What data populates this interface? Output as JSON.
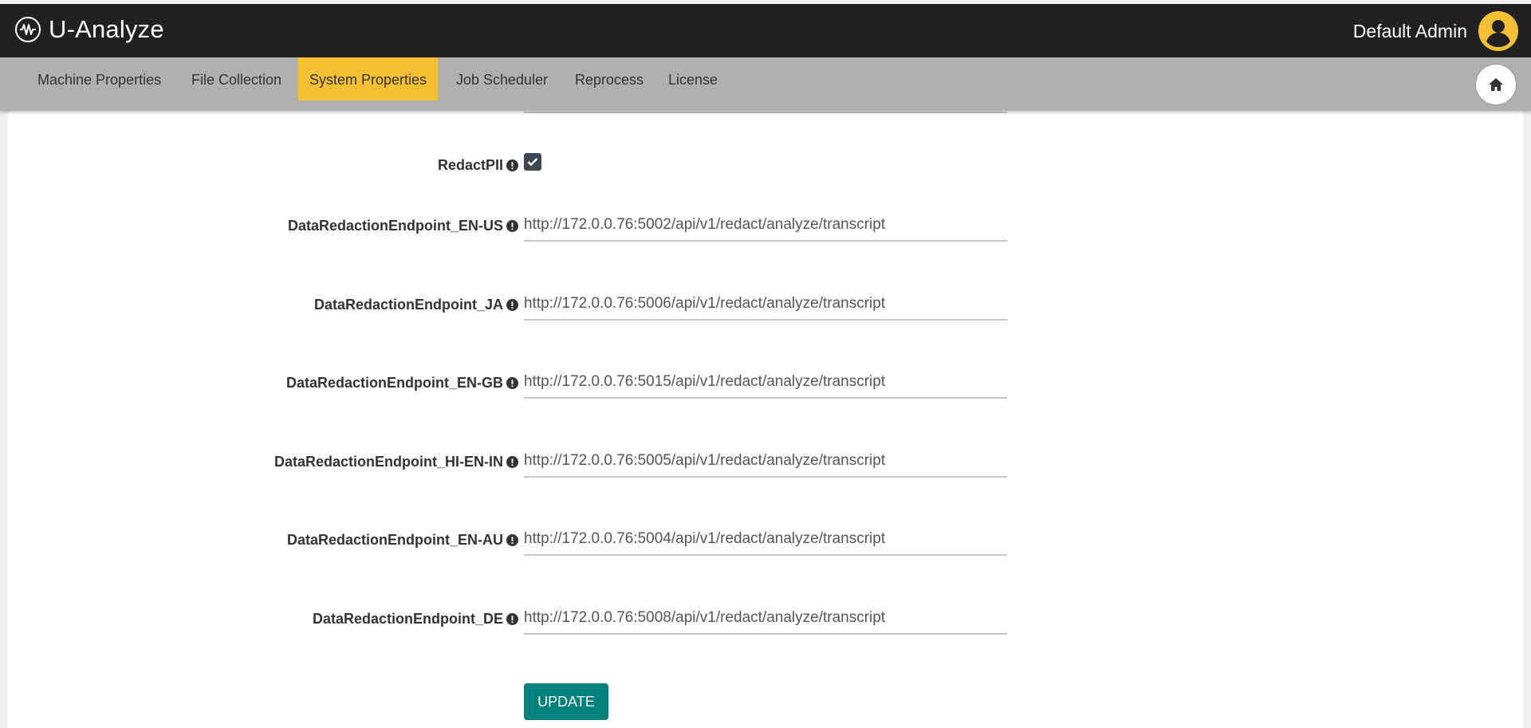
{
  "app": {
    "title": "U-Analyze",
    "logo_icon": "waveform-circle-icon"
  },
  "user": {
    "name": "Default Admin",
    "avatar_icon": "user-avatar-icon",
    "avatar_color": "#f3bf33"
  },
  "tabs": [
    {
      "label": "Machine Properties",
      "active": false
    },
    {
      "label": "File Collection",
      "active": false
    },
    {
      "label": "System Properties",
      "active": true
    },
    {
      "label": "Job Scheduler",
      "active": false
    },
    {
      "label": "Reprocess",
      "active": false
    },
    {
      "label": "License",
      "active": false
    }
  ],
  "home_button_icon": "home-icon",
  "settings": {
    "redact_pii": {
      "label": "RedactPII",
      "checked": true
    },
    "endpoints": [
      {
        "label": "DataRedactionEndpoint_EN-US",
        "value": "http://172.0.0.76:5002/api/v1/redact/analyze/transcript"
      },
      {
        "label": "DataRedactionEndpoint_JA",
        "value": "http://172.0.0.76:5006/api/v1/redact/analyze/transcript"
      },
      {
        "label": "DataRedactionEndpoint_EN-GB",
        "value": "http://172.0.0.76:5015/api/v1/redact/analyze/transcript"
      },
      {
        "label": "DataRedactionEndpoint_HI-EN-IN",
        "value": "http://172.0.0.76:5005/api/v1/redact/analyze/transcript"
      },
      {
        "label": "DataRedactionEndpoint_EN-AU",
        "value": "http://172.0.0.76:5004/api/v1/redact/analyze/transcript"
      },
      {
        "label": "DataRedactionEndpoint_DE",
        "value": "http://172.0.0.76:5008/api/v1/redact/analyze/transcript"
      }
    ]
  },
  "update_label": "UPDATE",
  "colors": {
    "appbar": "#212121",
    "tabbar": "#b0b0b0",
    "active_tab": "#f3bf33",
    "update_button": "#00827c",
    "checkbox": "#3f4654"
  }
}
